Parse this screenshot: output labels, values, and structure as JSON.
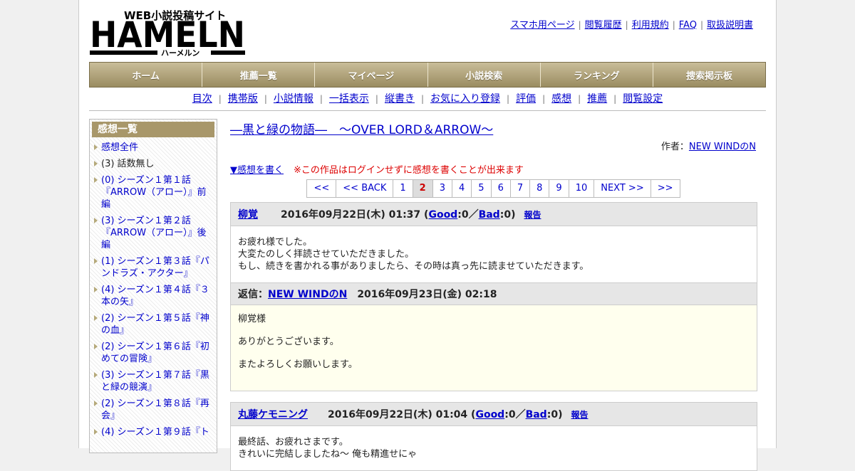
{
  "site": {
    "logo_text": "HAMELN",
    "logo_tagline": "WEB小説投稿サイト",
    "logo_kana": "ハーメルン"
  },
  "top_links": [
    "スマホ用ページ",
    "閲覧履歴",
    "利用規約",
    "FAQ",
    "取扱説明書"
  ],
  "main_nav": [
    "ホーム",
    "推薦一覧",
    "マイページ",
    "小説検索",
    "ランキング",
    "捜索掲示板"
  ],
  "sub_nav": [
    "目次",
    "携帯版",
    "小説情報",
    "一括表示",
    "縦書き",
    "お気に入り登録",
    "評価",
    "感想",
    "推薦",
    "閲覧設定"
  ],
  "sidebar": {
    "title": "感想一覧",
    "items": [
      {
        "label": "感想全件",
        "link": true
      },
      {
        "label": "(3) 話数無し",
        "link": false
      },
      {
        "label": "(0) シーズン１第１話『ARROW（アロー）』前編",
        "link": true
      },
      {
        "label": "(3) シーズン１第２話『ARROW（アロー）』後編",
        "link": true
      },
      {
        "label": "(1) シーズン１第３話『パンドラズ・アクター』",
        "link": true
      },
      {
        "label": "(4) シーズン１第４話『３本の矢』",
        "link": true
      },
      {
        "label": "(2) シーズン１第５話『神の血』",
        "link": true
      },
      {
        "label": "(2) シーズン１第６話『初めての冒険』",
        "link": true
      },
      {
        "label": "(3) シーズン１第７話『黒と緑の競演』",
        "link": true
      },
      {
        "label": "(2) シーズン１第８話『再会』",
        "link": true
      },
      {
        "label": "(4) シーズン１第９話『ト",
        "link": true
      }
    ]
  },
  "work": {
    "title": "―黒と緑の物語―　～OVER LORD＆ARROW～",
    "author_label": "作者：",
    "author": "NEW WINDのN"
  },
  "write_comment": "▼感想を書く",
  "notice": "※この作品はログインせずに感想を書くことが出来ます",
  "pager": [
    "<<",
    "<< BACK",
    "1",
    "2",
    "3",
    "4",
    "5",
    "6",
    "7",
    "8",
    "9",
    "10",
    "NEXT >>",
    ">>"
  ],
  "pager_current": "2",
  "comments": [
    {
      "user": "柳覚",
      "date": "2016年09月22日(木) 01:37",
      "good_label": "Good",
      "good": "0",
      "bad_label": "Bad",
      "bad": "0",
      "report": "報告",
      "body": [
        "お疲れ様でした。",
        "大変たのしく拝読させていただきました。",
        "もし、続きを書かれる事がありましたら、その時は真っ先に読ませていただきます。"
      ],
      "reply": {
        "label": "返信：",
        "author": "NEW WINDのN",
        "date": "2016年09月23日(金) 02:18",
        "body": [
          "柳覚様",
          "ありがとうございます。",
          "またよろしくお願いします。"
        ]
      }
    },
    {
      "user": "丸藤ケモニング",
      "date": "2016年09月22日(木) 01:04",
      "good_label": "Good",
      "good": "0",
      "bad_label": "Bad",
      "bad": "0",
      "report": "報告",
      "body": [
        "最終話、お疲れさまです。",
        "きれいに完結しましたね～ 俺も精進せにゃ"
      ]
    }
  ]
}
